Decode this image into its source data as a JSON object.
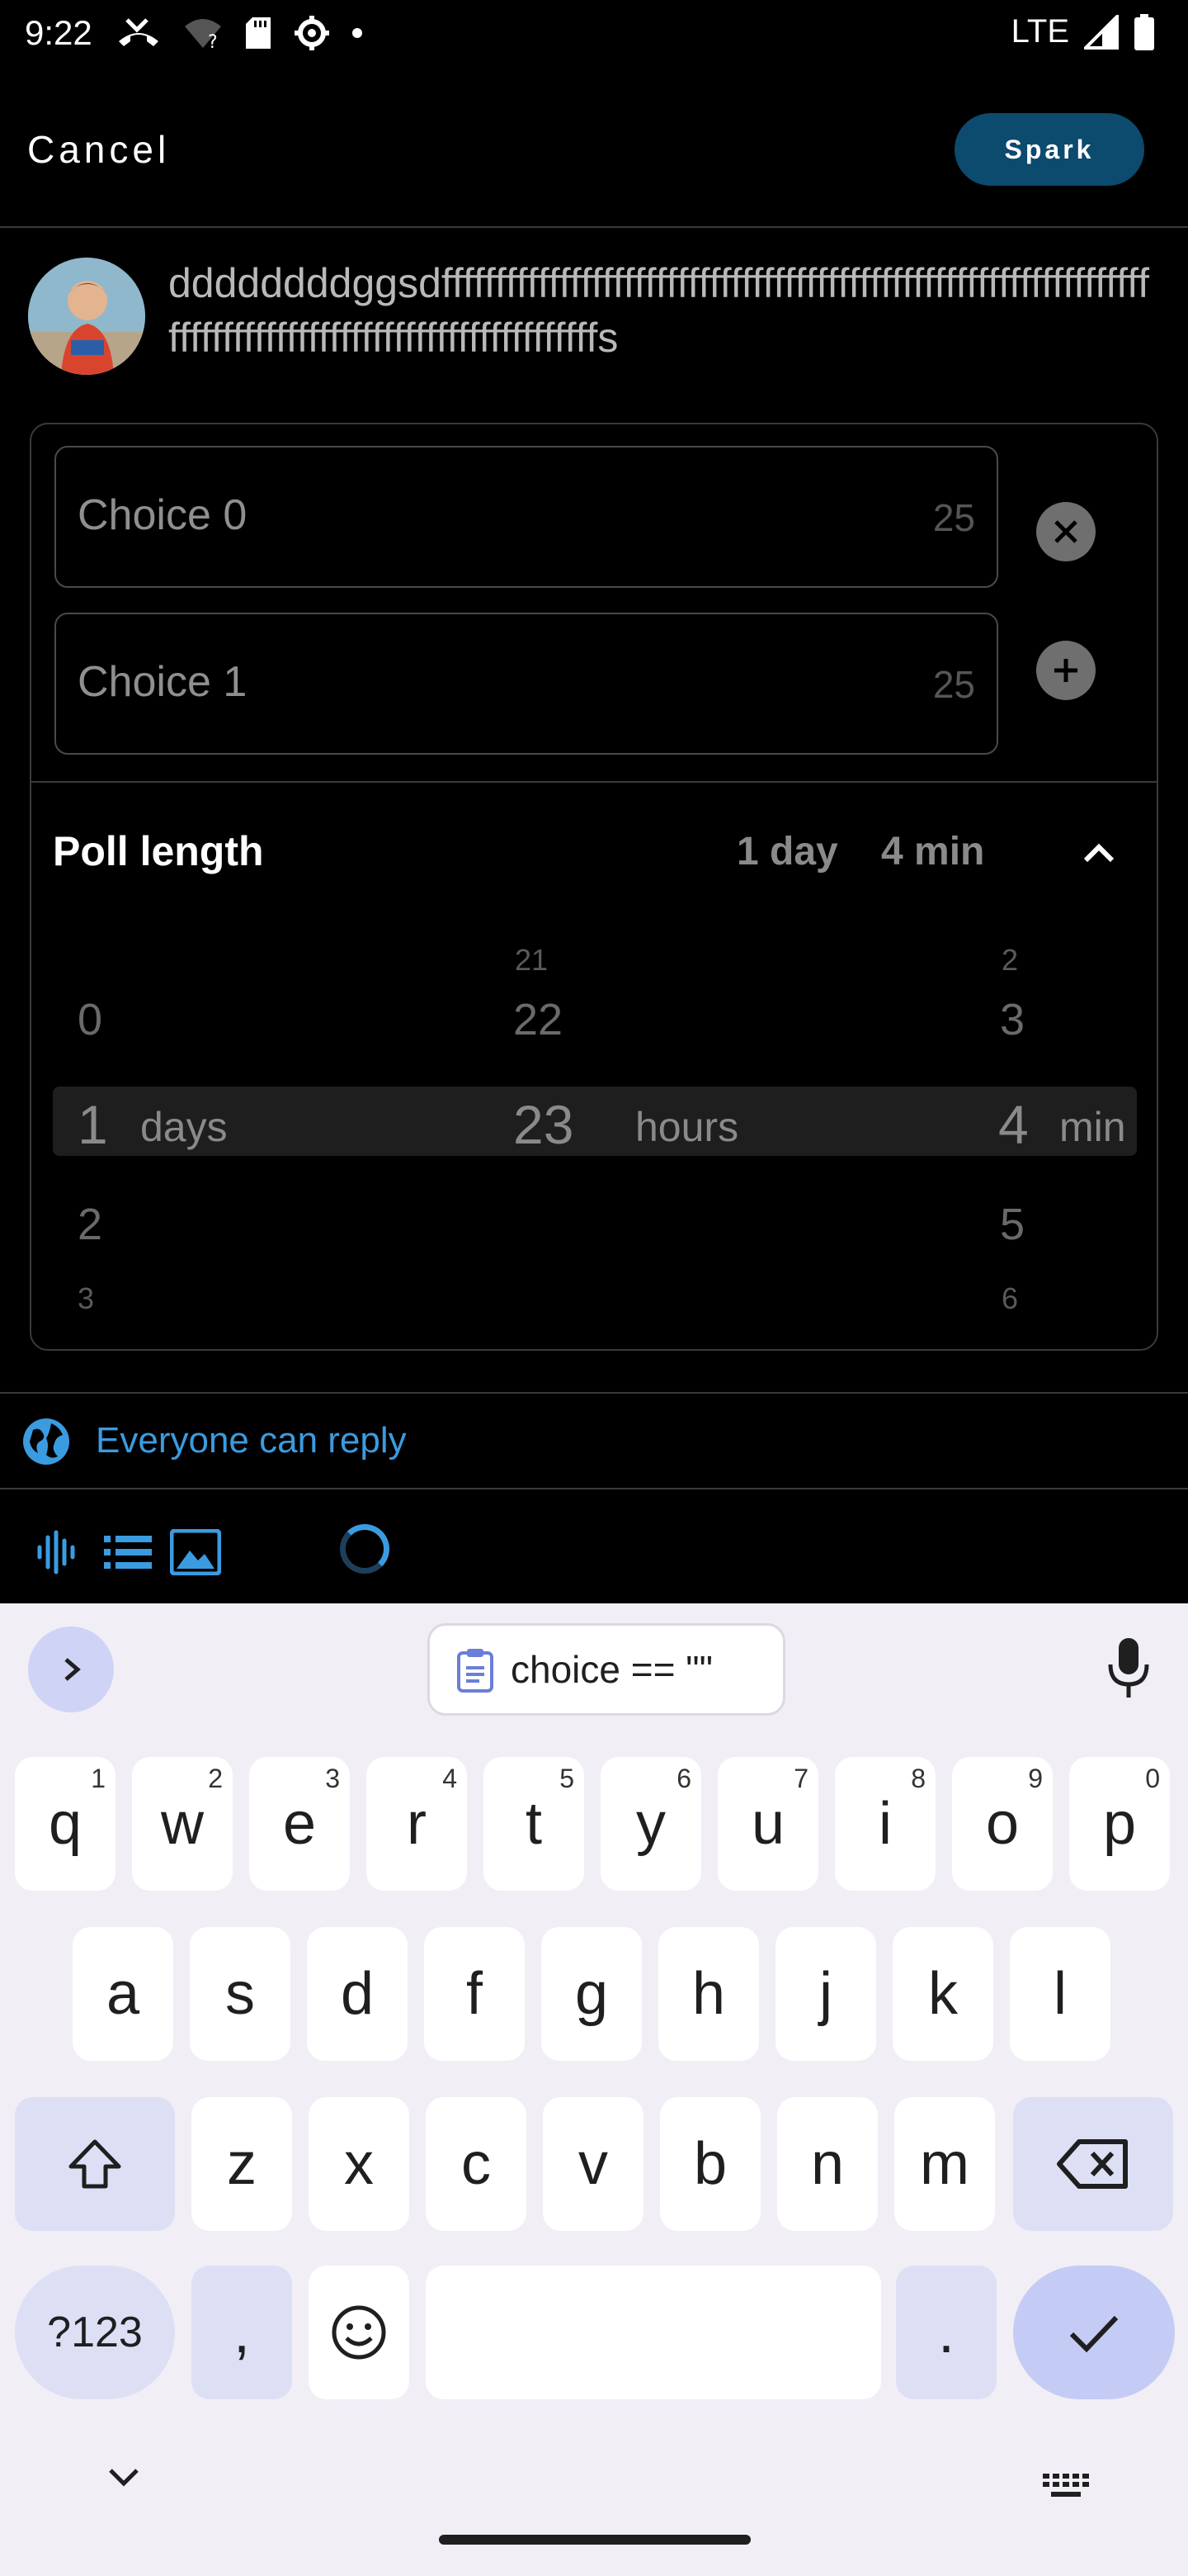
{
  "status_bar": {
    "time": "9:22",
    "network": "LTE",
    "icons_left": [
      "missed-call-icon",
      "wifi-unknown-icon",
      "sd-card-icon",
      "settings-icon",
      "dot-icon"
    ],
    "icons_right": [
      "signal-icon",
      "battery-icon"
    ]
  },
  "header": {
    "cancel_label": "Cancel",
    "spark_label": "Spark",
    "accent_color": "#0c4a6e"
  },
  "compose": {
    "text": "ddddddddggsdffffffffffffffffffffffffffffffffffffffffffffffffffffffffffffffffffffffffffffffffffffffffffffffffffffffffffs"
  },
  "poll": {
    "choices": [
      {
        "placeholder": "Choice 0",
        "counter": "25",
        "action_icon": "remove-circle-icon"
      },
      {
        "placeholder": "Choice 1",
        "counter": "25",
        "action_icon": "add-circle-icon"
      }
    ],
    "length_label": "Poll length",
    "length_day": "1 day",
    "length_min": "4 min",
    "picker": {
      "days": {
        "above2": "",
        "above1": "0",
        "selected": "1",
        "below1": "2",
        "below2": "3",
        "unit": "days"
      },
      "hours": {
        "above2": "21",
        "above1": "22",
        "selected": "23",
        "below1": "",
        "below2": "",
        "unit": "hours"
      },
      "minutes": {
        "above2": "2",
        "above1": "3",
        "selected": "4",
        "below1": "5",
        "below2": "6",
        "unit": "min"
      }
    }
  },
  "reply": {
    "label": "Everyone can reply",
    "color": "#3b9be0"
  },
  "toolbar": {
    "icons": [
      "audio-waveform-icon",
      "poll-list-icon",
      "image-icon",
      "loading-spinner-icon"
    ]
  },
  "keyboard": {
    "clipboard_suggestion": "choice == \"\"",
    "row1": [
      {
        "k": "q",
        "h": "1"
      },
      {
        "k": "w",
        "h": "2"
      },
      {
        "k": "e",
        "h": "3"
      },
      {
        "k": "r",
        "h": "4"
      },
      {
        "k": "t",
        "h": "5"
      },
      {
        "k": "y",
        "h": "6"
      },
      {
        "k": "u",
        "h": "7"
      },
      {
        "k": "i",
        "h": "8"
      },
      {
        "k": "o",
        "h": "9"
      },
      {
        "k": "p",
        "h": "0"
      }
    ],
    "row2": [
      "a",
      "s",
      "d",
      "f",
      "g",
      "h",
      "j",
      "k",
      "l"
    ],
    "row3": [
      "z",
      "x",
      "c",
      "v",
      "b",
      "n",
      "m"
    ],
    "sym_label": "?123",
    "comma_label": ",",
    "period_label": "."
  }
}
